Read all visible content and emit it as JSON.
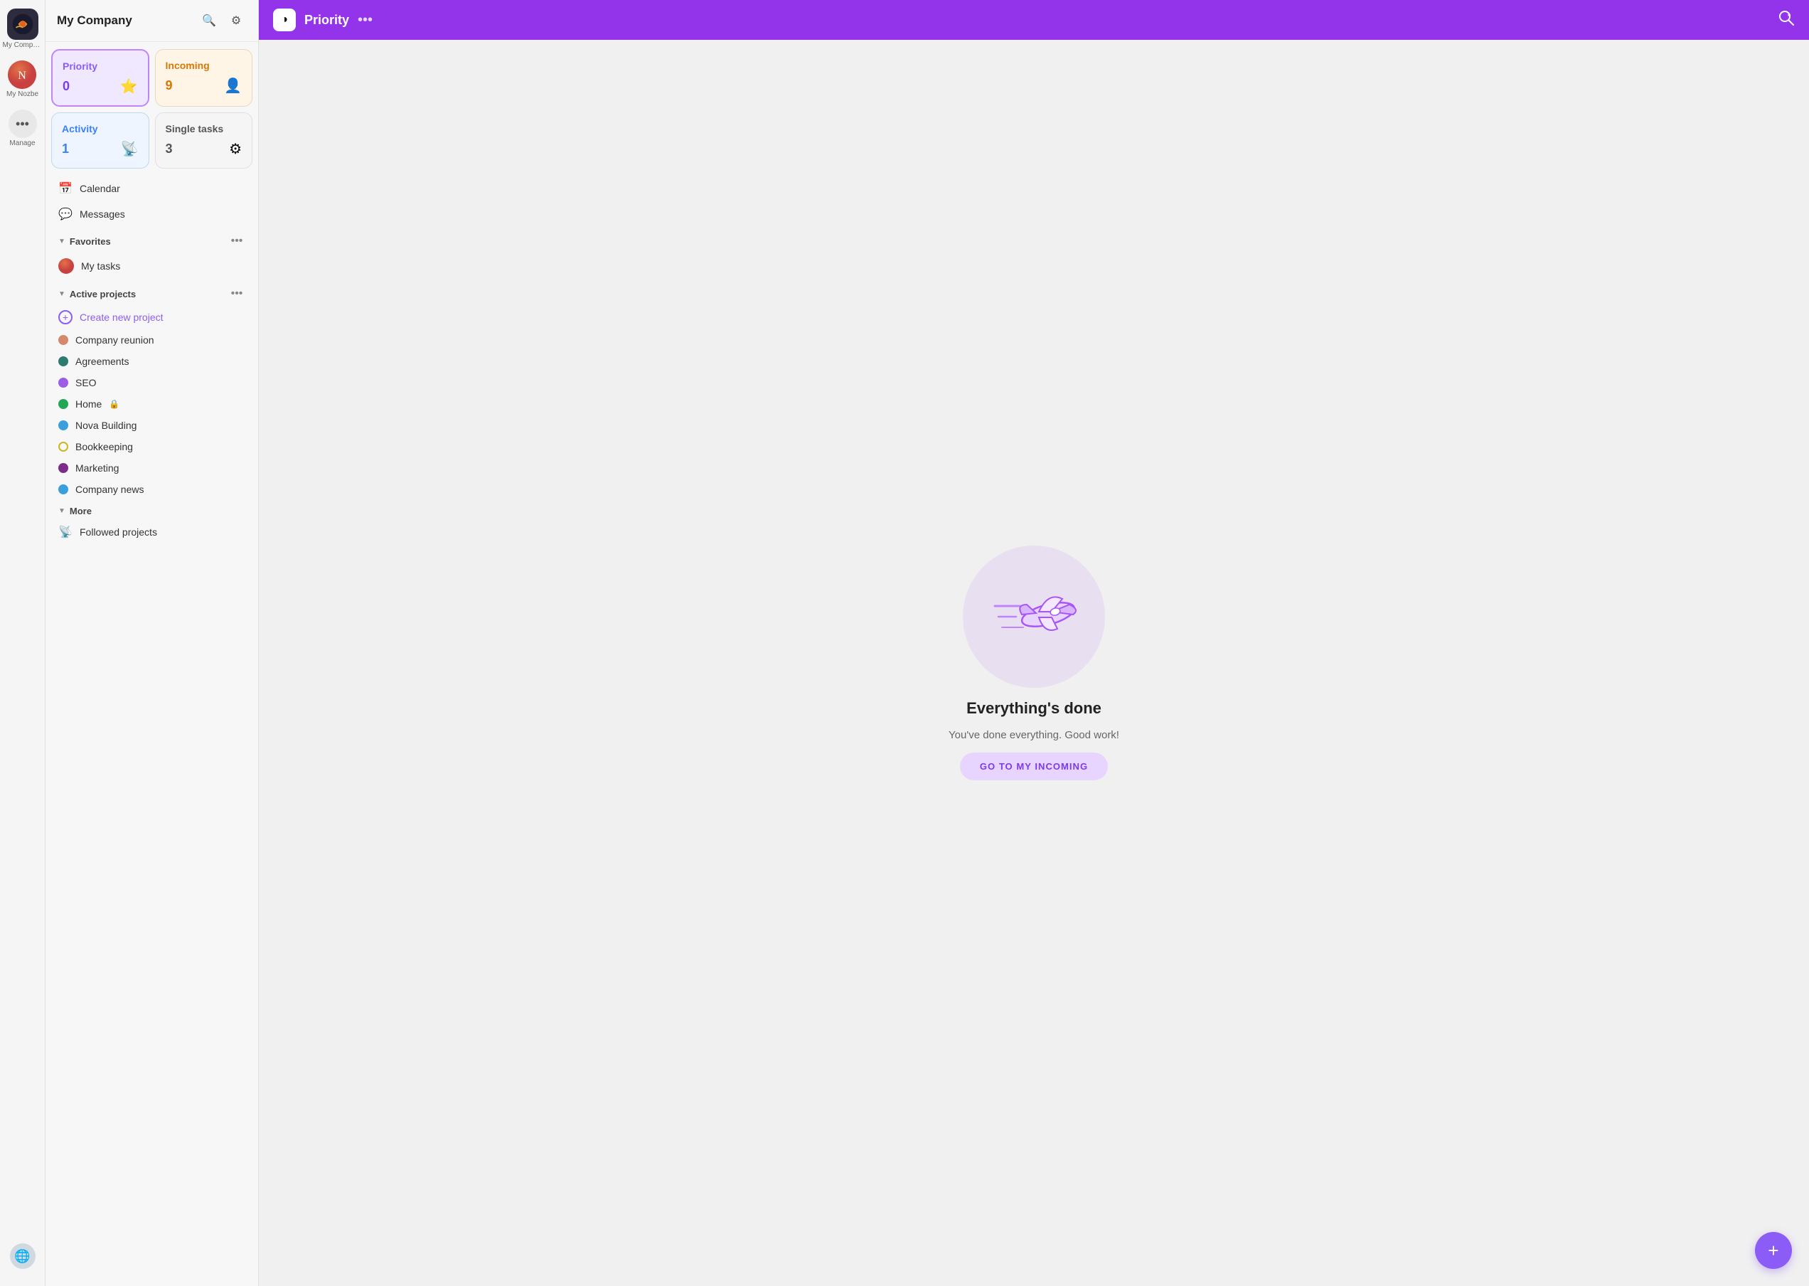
{
  "rail": {
    "app_name": "My Company",
    "my_nozbe": "My Nozbe",
    "manage": "Manage"
  },
  "sidebar": {
    "title": "My Company",
    "search_label": "Search",
    "settings_label": "Settings"
  },
  "cards": [
    {
      "id": "priority",
      "label": "Priority",
      "count": "0",
      "icon": "★",
      "type": "priority"
    },
    {
      "id": "incoming",
      "label": "Incoming",
      "count": "9",
      "icon": "👤",
      "type": "incoming"
    },
    {
      "id": "activity",
      "label": "Activity",
      "count": "1",
      "icon": "📡",
      "type": "activity"
    },
    {
      "id": "single",
      "label": "Single tasks",
      "count": "3",
      "icon": "⚙",
      "type": "single"
    }
  ],
  "nav_items": [
    {
      "id": "calendar",
      "label": "Calendar",
      "icon": "📅"
    },
    {
      "id": "messages",
      "label": "Messages",
      "icon": "💬"
    }
  ],
  "favorites": {
    "label": "Favorites",
    "items": [
      {
        "id": "my-tasks",
        "label": "My tasks",
        "has_avatar": true
      }
    ]
  },
  "active_projects": {
    "label": "Active projects",
    "items": [
      {
        "id": "company-reunion",
        "label": "Company reunion",
        "color": "#d4896a"
      },
      {
        "id": "agreements",
        "label": "Agreements",
        "color": "#2d7a6e"
      },
      {
        "id": "seo",
        "label": "SEO",
        "color": "#9c5ce8"
      },
      {
        "id": "home",
        "label": "Home",
        "color": "#22a855",
        "locked": true
      },
      {
        "id": "nova-building",
        "label": "Nova Building",
        "color": "#3b9fde"
      },
      {
        "id": "bookkeeping",
        "label": "Bookkeeping",
        "color": "#c9b820"
      },
      {
        "id": "marketing",
        "label": "Marketing",
        "color": "#7c2d8a"
      },
      {
        "id": "company-news",
        "label": "Company news",
        "color": "#3b9fde"
      }
    ]
  },
  "more": {
    "label": "More",
    "items": [
      {
        "id": "followed-projects",
        "label": "Followed projects",
        "icon": "📡"
      }
    ]
  },
  "topbar": {
    "logo_icon": "◑",
    "title": "Priority",
    "dots_label": "•••",
    "search_icon": "🔍"
  },
  "main": {
    "empty_title": "Everything's done",
    "empty_subtitle": "You've done everything. Good work!",
    "go_incoming_btn": "GO TO MY INCOMING",
    "fab_icon": "+"
  }
}
